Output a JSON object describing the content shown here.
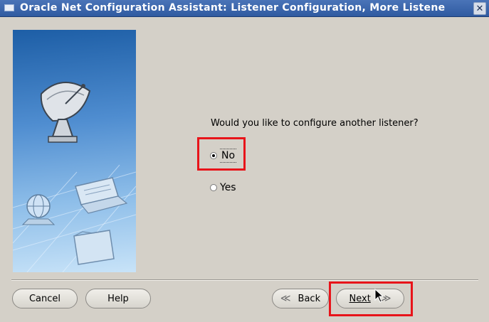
{
  "window": {
    "title": "Oracle Net Configuration Assistant: Listener Configuration, More Listene",
    "close_glyph": "✕"
  },
  "question": "Would you like to configure another listener?",
  "options": [
    {
      "label": "No",
      "selected": true
    },
    {
      "label": "Yes",
      "selected": false
    }
  ],
  "buttons": {
    "cancel": "Cancel",
    "help": "Help",
    "back": "Back",
    "next": "Next",
    "back_glyph": "≪",
    "next_glyph": "≫"
  },
  "colors": {
    "annotation": "#e8141a",
    "titlebar": "#2f5aa0"
  },
  "icons": [
    "satellite-dish-icon",
    "globe-icon",
    "laptop-icon",
    "folder-icon"
  ]
}
